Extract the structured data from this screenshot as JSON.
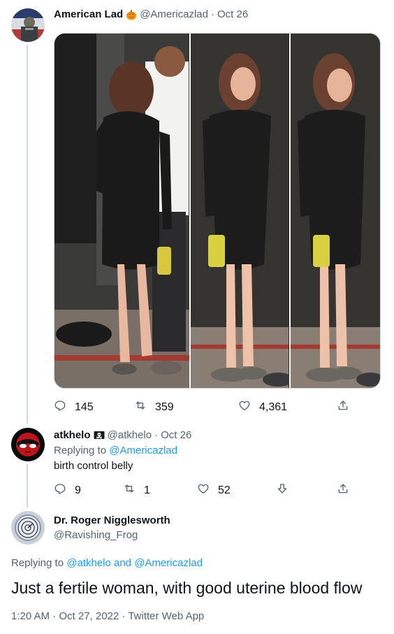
{
  "tweet1": {
    "display_name": "American Lad",
    "handle": "@Americazlad",
    "separator": "·",
    "date": "Oct 26",
    "name_emoji": "pumpkin-icon",
    "actions": {
      "replies": "145",
      "retweets": "359",
      "likes": "4,361"
    }
  },
  "tweet2": {
    "display_name": "atkhelo",
    "handle": "@atkhelo",
    "separator": "·",
    "date": "Oct 26",
    "name_emoji": "skull-flag-icon",
    "replying_prefix": "Replying to",
    "replying_to": "@Americazlad",
    "text": "birth control belly",
    "actions": {
      "replies": "9",
      "retweets": "1",
      "likes": "52"
    }
  },
  "tweet3": {
    "display_name": "Dr. Roger Nigglesworth",
    "handle": "@Ravishing_Frog",
    "replying_prefix": "Replying to",
    "replying_to_1": "@atkhelo",
    "and": "and",
    "replying_to_2": "@Americazlad",
    "text": "Just a fertile woman, with good uterine blood flow",
    "timestamp": "1:20 AM · Oct 27, 2022 · Twitter Web App"
  },
  "colors": {
    "link": "#1d9bf0",
    "secondary_text": "#536471",
    "thread_line": "#cfd9de"
  }
}
